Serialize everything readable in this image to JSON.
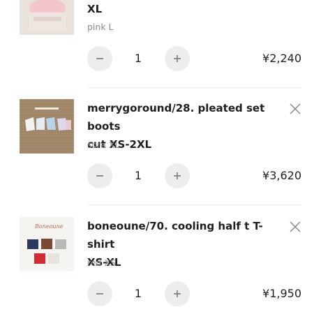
{
  "cart": {
    "items": [
      {
        "title_line2": "XL",
        "variant": "pink L",
        "quantity": "1",
        "price": "¥2,240"
      },
      {
        "title_line1": "merrygoround/28. pleated set boots",
        "title_line2": "cut XS-2XL",
        "variant": "sora XL",
        "quantity": "1",
        "price": "¥3,620"
      },
      {
        "title_line1": "boneoune/70. cooling half t T-shirt",
        "title_line2": "XS-XL",
        "variant": "red XS",
        "quantity": "1",
        "price": "¥1,950"
      }
    ]
  },
  "icons": {
    "remove": "close-icon",
    "decrease": "minus-icon",
    "increase": "plus-icon"
  },
  "colors": {
    "qty_button_bg": "#ededed",
    "divider": "#ececec",
    "variant_text": "#8a8a8a"
  }
}
